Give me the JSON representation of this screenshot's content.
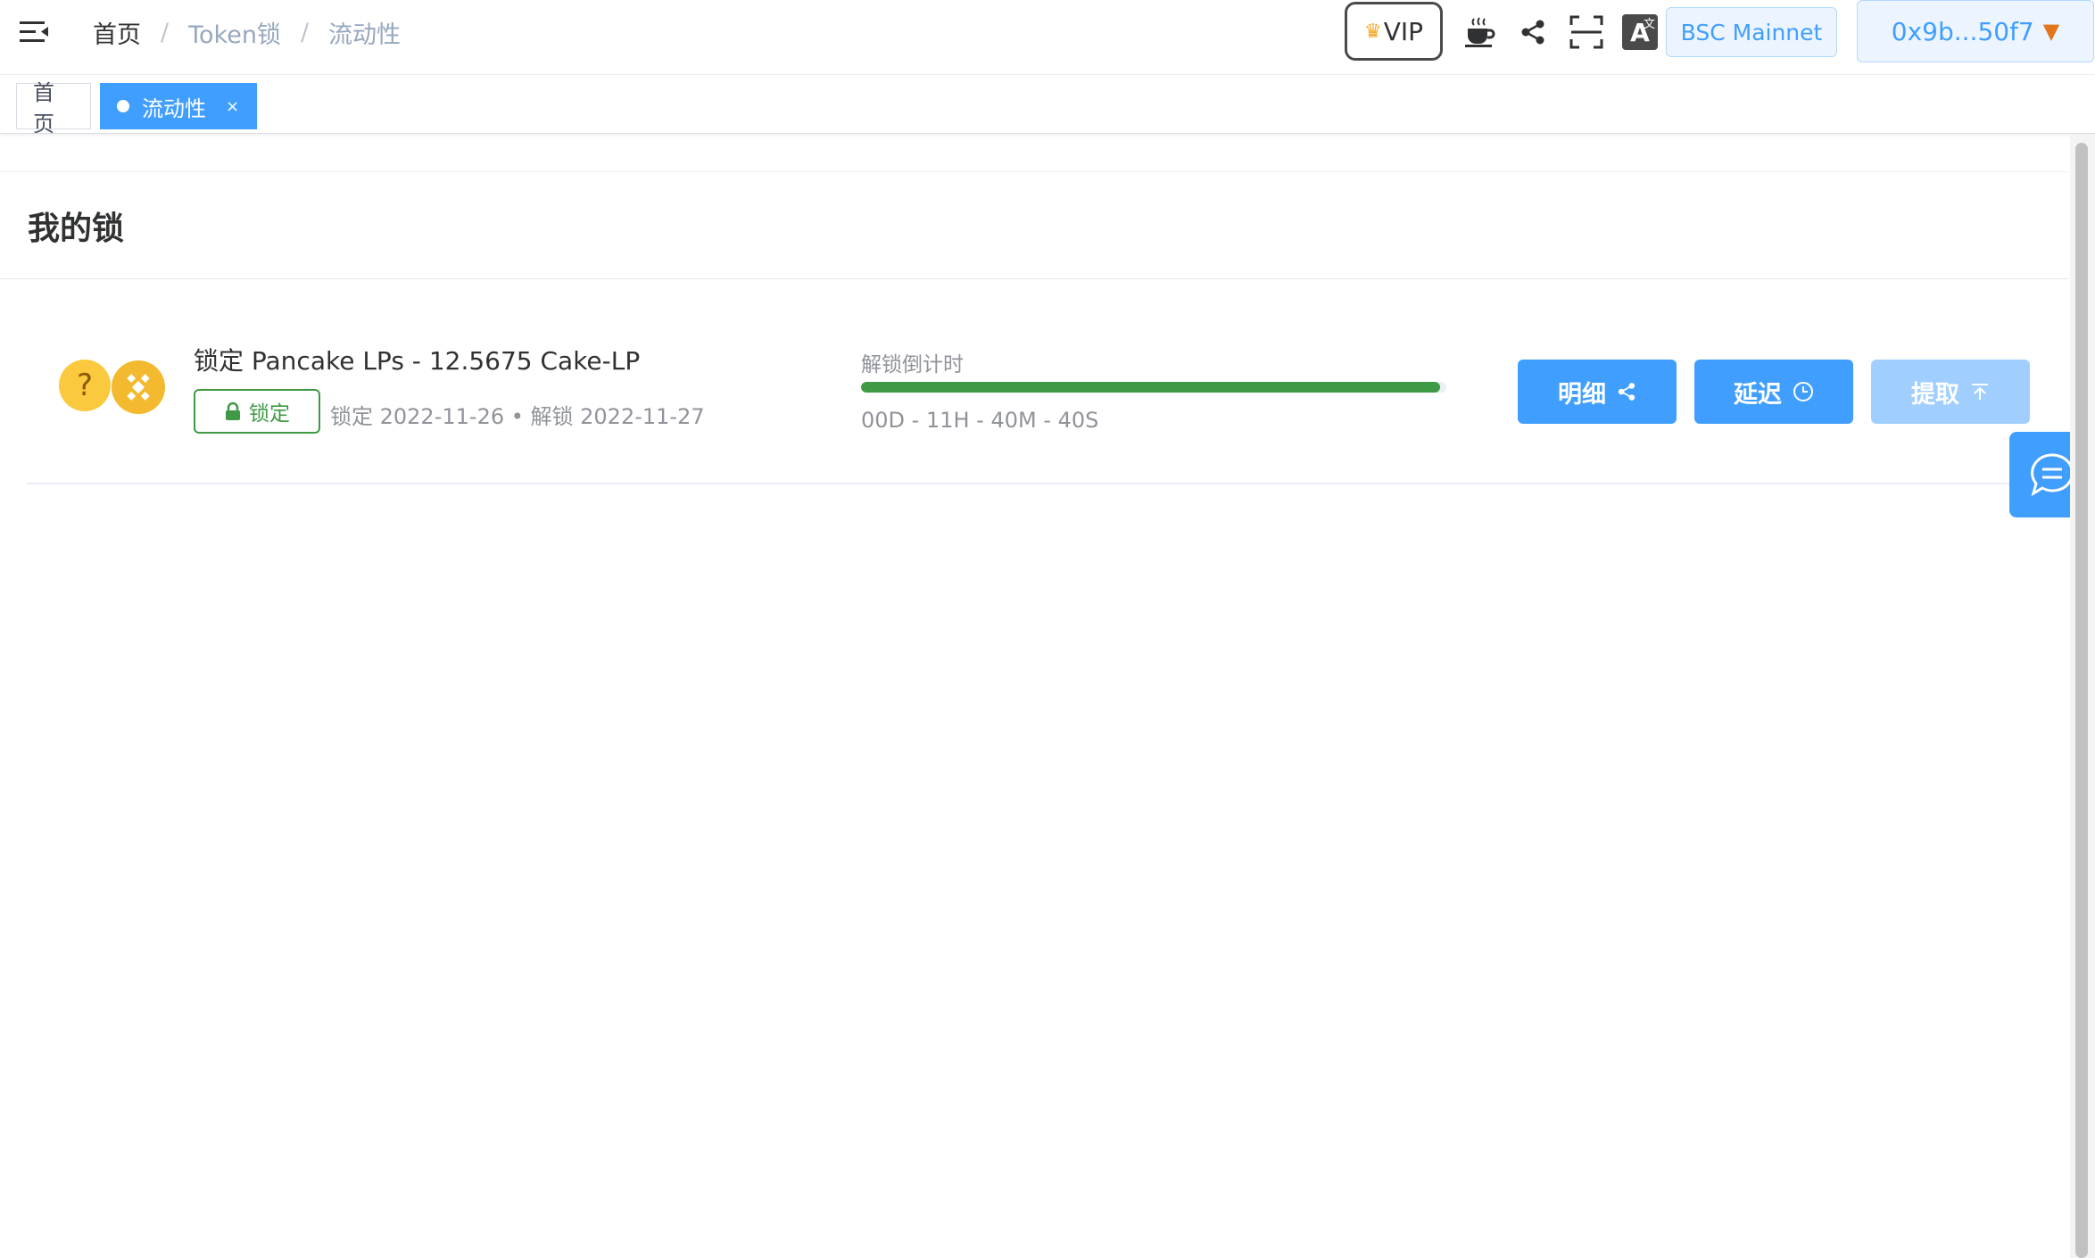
{
  "header": {
    "breadcrumb": [
      "首页",
      "Token锁",
      "流动性"
    ],
    "vip_label": "VIP",
    "network_label": "BSC Mainnet",
    "wallet_label": "0x9b...50f7",
    "icons": [
      "menu-toggle-icon",
      "coffee-icon",
      "share-icon",
      "fullscreen-icon",
      "translate-icon"
    ]
  },
  "tags": {
    "home": "首页",
    "active": "流动性",
    "close": "×"
  },
  "card": {
    "title": "我的锁"
  },
  "lock": {
    "title": "锁定 Pancake LPs - 12.5675 Cake-LP",
    "badge": "锁定",
    "dates": "锁定 2022-11-26 • 解锁 2022-11-27",
    "countdown_label": "解锁倒计时",
    "countdown": "00D - 11H - 40M - 40S",
    "progress_percent": 99,
    "progress_color": "#3f9a46"
  },
  "actions": {
    "detail": "明细",
    "extend": "延迟",
    "withdraw": "提取"
  },
  "colors": {
    "primary": "#409eff",
    "primary_light": "#a0cfff",
    "success": "#3f9a46"
  }
}
